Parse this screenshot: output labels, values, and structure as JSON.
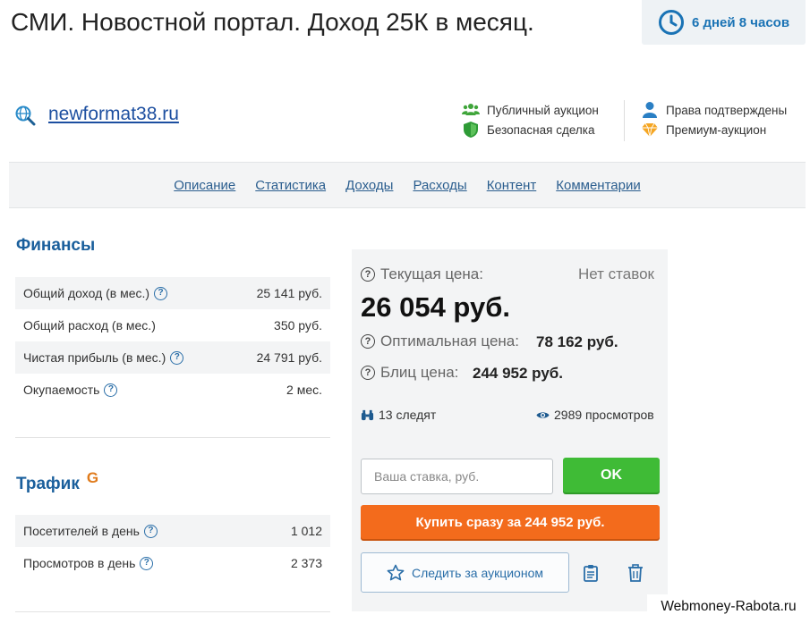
{
  "header": {
    "title": "СМИ. Новостной портал. Доход 25К в месяц.",
    "timer": "6 дней 8 часов"
  },
  "site": {
    "domain": "newformat38.ru"
  },
  "features": {
    "public_auction": "Публичный аукцион",
    "safe_deal": "Безопасная сделка",
    "rights_confirmed": "Права подтверждены",
    "premium_auction": "Премиум-аукцион"
  },
  "nav": {
    "items": [
      "Описание",
      "Статистика",
      "Доходы",
      "Расходы",
      "Контент",
      "Комментарии"
    ]
  },
  "finance": {
    "heading": "Финансы",
    "rows": [
      {
        "label": "Общий доход (в мес.)",
        "value": "25 141 руб."
      },
      {
        "label": "Общий расход (в мес.)",
        "value": "350 руб."
      },
      {
        "label": "Чистая прибыль (в мес.)",
        "value": "24 791 руб."
      },
      {
        "label": "Окупаемость",
        "value": "2 мес."
      }
    ]
  },
  "traffic": {
    "heading": "Трафик",
    "badge": "G",
    "rows": [
      {
        "label": "Посетителей в день",
        "value": "1 012"
      },
      {
        "label": "Просмотров в день",
        "value": "2 373"
      }
    ]
  },
  "price": {
    "current_label": "Текущая цена:",
    "no_bids": "Нет ставок",
    "current_value": "26 054 руб.",
    "optimal_label": "Оптимальная цена:",
    "optimal_value": "78 162 руб.",
    "blitz_label": "Блиц цена:",
    "blitz_value": "244 952 руб.",
    "watchers": "13 следят",
    "views": "2989 просмотров"
  },
  "actions": {
    "bid_placeholder": "Ваша ставка, руб.",
    "ok_label": "OK",
    "buy_label": "Купить сразу за 244 952 руб.",
    "follow_label": "Следить за аукционом"
  },
  "watermark": "Webmoney-Rabota.ru",
  "colors": {
    "accent_blue": "#1a73b5",
    "ok_green": "#3fbb36",
    "buy_orange": "#f36b1c"
  }
}
